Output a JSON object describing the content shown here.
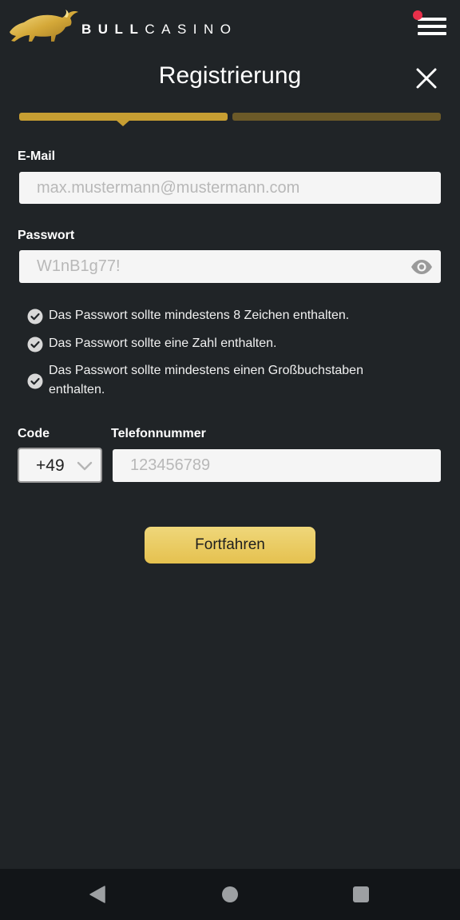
{
  "header": {
    "brand_bold": "BULL",
    "brand_light": "CASINO",
    "logo_icon": "bull-logo-icon",
    "menu_icon": "hamburger-menu-icon"
  },
  "page": {
    "title": "Registrierung",
    "close_icon": "close-icon",
    "progress": {
      "current_step": 1,
      "total_steps": 2
    }
  },
  "form": {
    "email": {
      "label": "E-Mail",
      "placeholder": "max.mustermann@mustermann.com"
    },
    "password": {
      "label": "Passwort",
      "value": "W1nB1g77!",
      "toggle_icon": "eye-icon"
    },
    "password_rules": [
      {
        "text": "Das Passwort sollte mindestens 8 Zeichen enthalten."
      },
      {
        "text": "Das Passwort sollte eine Zahl enthalten."
      },
      {
        "text": "Das Passwort sollte mindestens einen Großbuchstaben enthalten."
      }
    ],
    "code": {
      "label": "Code",
      "value": "+49"
    },
    "phone": {
      "label": "Telefonnummer",
      "placeholder": "123456789"
    },
    "submit_label": "Fortfahren"
  },
  "colors": {
    "background": "#202427",
    "accent_gold": "#c79e32",
    "accent_gold_dim": "#6c5a28",
    "notification": "#e8304a"
  },
  "system_nav": {
    "back_icon": "back-triangle-icon",
    "home_icon": "home-circle-icon",
    "recent_icon": "recent-apps-square-icon"
  }
}
